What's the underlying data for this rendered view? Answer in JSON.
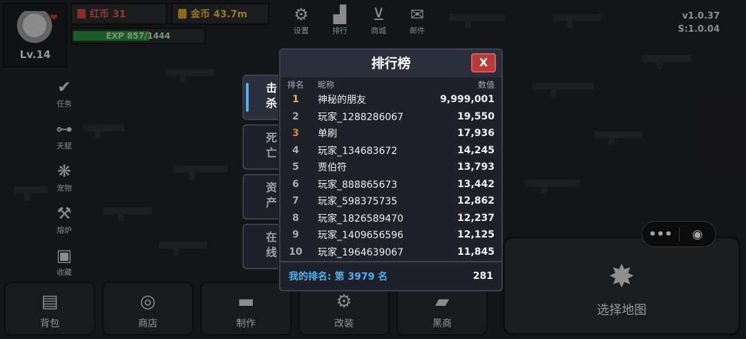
{
  "player": {
    "level": "Lv.14",
    "exp": "EXP 857/1444",
    "exp_fraction": 0.593,
    "red_coin_label": "红币 31",
    "gold_coin_label": "金币 43.7m"
  },
  "top_icons": [
    {
      "icon": "gear-icon",
      "label": "设置"
    },
    {
      "icon": "ranking-icon",
      "label": "排行"
    },
    {
      "icon": "cart-icon",
      "label": "商城"
    },
    {
      "icon": "mail-icon",
      "label": "邮件"
    }
  ],
  "version": {
    "client": "v1.0.37",
    "server": "S:1.0.04"
  },
  "side_menu": [
    {
      "icon": "clipboard-icon",
      "label": "任务"
    },
    {
      "icon": "dumbbell-icon",
      "label": "天赋"
    },
    {
      "icon": "paw-icon",
      "label": "宠物"
    },
    {
      "icon": "hammer-icon",
      "label": "熔炉"
    },
    {
      "icon": "collection-icon",
      "label": "收藏"
    }
  ],
  "bottom_bar": [
    {
      "icon": "backpack-icon",
      "label": "背包"
    },
    {
      "icon": "coins-icon",
      "label": "商店"
    },
    {
      "icon": "anvil-icon",
      "label": "制作"
    },
    {
      "icon": "wrench-icon",
      "label": "改装"
    },
    {
      "icon": "gold-bars-icon",
      "label": "黑商"
    }
  ],
  "map_button": {
    "icon": "map-icon",
    "label": "选择地图"
  },
  "capsule": {
    "more": "•••",
    "close": "◉"
  },
  "leaderboard": {
    "title": "排行榜",
    "close_label": "X",
    "columns": {
      "rank": "排名",
      "name": "昵称",
      "value": "数值"
    },
    "tabs": [
      {
        "label": "击杀",
        "active": true
      },
      {
        "label": "死亡",
        "active": false
      },
      {
        "label": "资产",
        "active": false
      },
      {
        "label": "在线",
        "active": false
      }
    ],
    "rows": [
      {
        "rank": "1",
        "name": "神秘的朋友",
        "value": "9,999,001"
      },
      {
        "rank": "2",
        "name": "玩家_1288286067",
        "value": "19,550"
      },
      {
        "rank": "3",
        "name": "单刷",
        "value": "17,936"
      },
      {
        "rank": "4",
        "name": "玩家_134683672",
        "value": "14,245"
      },
      {
        "rank": "5",
        "name": "贾伯符",
        "value": "13,793"
      },
      {
        "rank": "6",
        "name": "玩家_888865673",
        "value": "13,442"
      },
      {
        "rank": "7",
        "name": "玩家_598375735",
        "value": "12,862"
      },
      {
        "rank": "8",
        "name": "玩家_1826589470",
        "value": "12,237"
      },
      {
        "rank": "9",
        "name": "玩家_1409656596",
        "value": "12,125"
      },
      {
        "rank": "10",
        "name": "玩家_1964639067",
        "value": "11,845"
      }
    ],
    "my_rank": "我的排名: 第 3979 名",
    "my_value": "281"
  }
}
